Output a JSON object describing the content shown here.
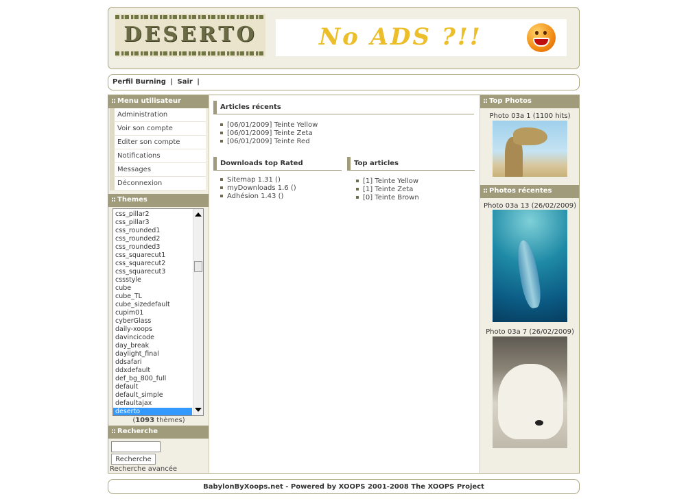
{
  "header": {
    "logo_text": "DESERTO",
    "banner_text": "No ADS ?!!"
  },
  "topnav": {
    "items": [
      "Perfil Burning",
      "|",
      "Sair",
      "|"
    ]
  },
  "user_menu": {
    "title": "Menu utilisateur",
    "items": [
      "Administration",
      "Voir son compte",
      "Editer son compte",
      "Notifications",
      "Messages",
      "Déconnexion"
    ]
  },
  "themes": {
    "title": "Themes",
    "items": [
      "css_pillar2",
      "css_pillar3",
      "css_rounded1",
      "css_rounded2",
      "css_rounded3",
      "css_squarecut1",
      "css_squarecut2",
      "css_squarecut3",
      "cssstyle",
      "cube",
      "cube_TL",
      "cube_sizedefault",
      "cupim01",
      "cyberGlass",
      "daily-xoops",
      "davincicode",
      "day_break",
      "daylight_final",
      "ddsafari",
      "ddxdefault",
      "def_bg_800_full",
      "default",
      "default_simple",
      "defaultajax",
      "deserto"
    ],
    "selected": "deserto",
    "count": "1093",
    "count_suffix": "thèmes",
    "open_paren": "(",
    "close_paren": ")"
  },
  "search": {
    "title": "Recherche",
    "button": "Recherche",
    "advanced": "Recherche avancée",
    "value": ""
  },
  "center": {
    "recent_title": "Articles récents",
    "recent": [
      "[06/01/2009] Teinte Yellow",
      "[06/01/2009] Teinte Zeta",
      "[06/01/2009] Teinte Red"
    ],
    "downloads_title": "Downloads top Rated",
    "downloads": [
      "Sitemap 1.31 ()",
      "myDownloads 1.6 ()",
      "Adhésion 1.43 ()"
    ],
    "top_articles_title": "Top articles",
    "top_articles": [
      "[1] Teinte Yellow",
      "[1] Teinte Zeta",
      "[0] Teinte Brown"
    ]
  },
  "right": {
    "top_photos_title": "Top Photos",
    "top_photo_caption": "Photo 03a 1 (1100 hits)",
    "recent_photos_title": "Photos récentes",
    "recent_photo1_caption": "Photo 03a 13 (26/02/2009)",
    "recent_photo2_caption": "Photo 03a 7 (26/02/2009)"
  },
  "footer": {
    "text": "BabylonByXoops.net - Powered by XOOPS 2001-2008 The XOOPS Project"
  },
  "colors": {
    "block_title_bg": "#a09c7b",
    "column_bg": "#f1efe3",
    "selected_bg": "#3399ff"
  }
}
